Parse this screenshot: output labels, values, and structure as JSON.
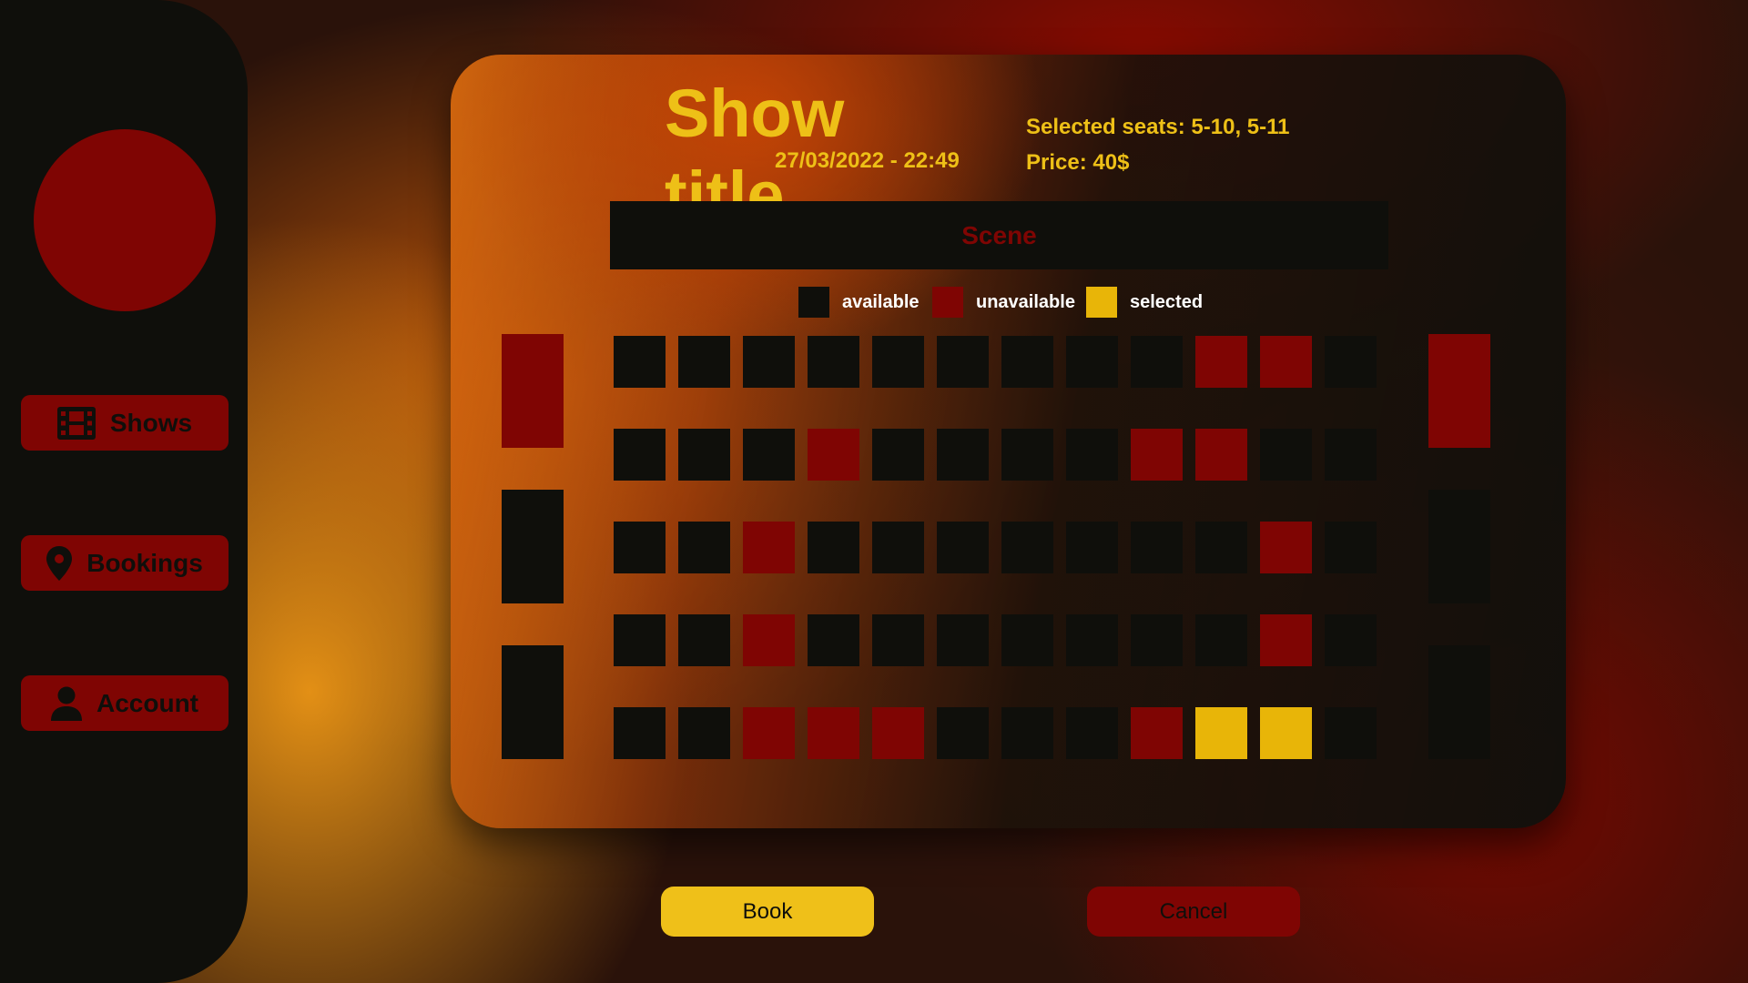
{
  "sidebar": {
    "nav": [
      {
        "label": "Shows",
        "icon": "film-icon"
      },
      {
        "label": "Bookings",
        "icon": "map-pin-icon"
      },
      {
        "label": "Account",
        "icon": "user-icon"
      }
    ]
  },
  "show": {
    "title": "Show title",
    "datetime": "27/03/2022 - 22:49",
    "selected_seats": "Selected seats: 5-10, 5-11",
    "price": "Price: 40$"
  },
  "hall": {
    "scene_label": "Scene",
    "legend": [
      {
        "label": "available",
        "color": "#0f0f0b"
      },
      {
        "label": "unavailable",
        "color": "#7f0503"
      },
      {
        "label": "selected",
        "color": "#e8b508"
      }
    ],
    "seat_rows": [
      [
        "available",
        "available",
        "available",
        "available",
        "available",
        "available",
        "available",
        "available",
        "available",
        "unavailable",
        "unavailable",
        "available"
      ],
      [
        "available",
        "available",
        "available",
        "unavailable",
        "available",
        "available",
        "available",
        "available",
        "unavailable",
        "unavailable",
        "available",
        "available"
      ],
      [
        "available",
        "available",
        "unavailable",
        "available",
        "available",
        "available",
        "available",
        "available",
        "available",
        "available",
        "unavailable",
        "available"
      ],
      [
        "available",
        "available",
        "unavailable",
        "available",
        "available",
        "available",
        "available",
        "available",
        "available",
        "available",
        "unavailable",
        "available"
      ],
      [
        "available",
        "available",
        "unavailable",
        "unavailable",
        "unavailable",
        "available",
        "available",
        "available",
        "unavailable",
        "selected",
        "selected",
        "available"
      ]
    ],
    "left_boxes": [
      "unavailable",
      "available",
      "available"
    ],
    "right_boxes": [
      "unavailable",
      "available",
      "available"
    ]
  },
  "actions": {
    "book_label": "Book",
    "cancel_label": "Cancel"
  },
  "colors": {
    "accent": "#eec017",
    "dark": "#0f0f0b",
    "red": "#7f0503",
    "selected": "#e8b508"
  }
}
